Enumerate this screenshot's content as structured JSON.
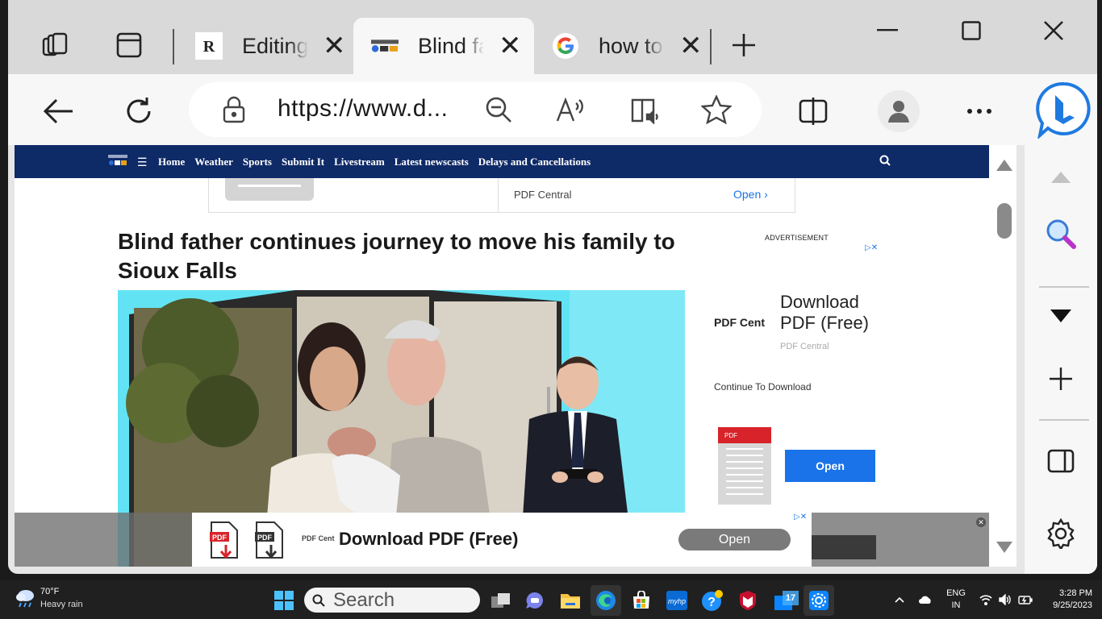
{
  "browser": {
    "tabs": [
      {
        "title": "Editing",
        "favicon": "rr-logo"
      },
      {
        "title": "Blind father continues journey",
        "favicon": "dakota-news-now-logo"
      },
      {
        "title": "how to",
        "favicon": "google-g-logo"
      }
    ],
    "url_host": "https://www.d",
    "url_display": "https://www.d...",
    "accent_color": "#0e2a67"
  },
  "site": {
    "menu": [
      "Home",
      "Weather",
      "Sports",
      "Submit It",
      "Livestream",
      "Latest newscasts",
      "Delays and Cancellations"
    ]
  },
  "top_ad": {
    "brand": "PDF Central",
    "open": "Open"
  },
  "article": {
    "headline": "Blind father continues journey to move his family to Sioux Falls"
  },
  "side_ad": {
    "label": "ADVERTISEMENT",
    "brand": "PDF Cent",
    "title_line1": "Download",
    "title_line2": "PDF (Free)",
    "sub": "PDF Central",
    "cta": "Continue To Download",
    "pdf_badge": "PDF",
    "open": "Open"
  },
  "bottom_ad": {
    "brand": "PDF Cent",
    "title": "Download PDF (Free)",
    "open": "Open",
    "pdf_badge": "PDF"
  },
  "taskbar": {
    "temp": "70°F",
    "condition": "Heavy rain",
    "search": "Search",
    "lang1": "ENG",
    "lang2": "IN",
    "time": "3:28 PM",
    "date": "9/25/2023"
  }
}
